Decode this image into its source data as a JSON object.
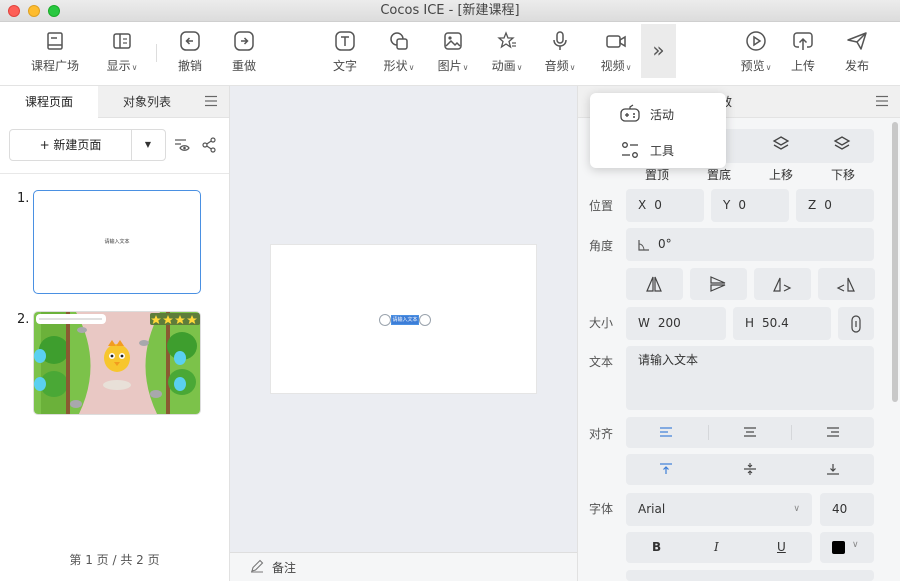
{
  "window": {
    "title": "Cocos ICE - [新建课程]"
  },
  "toolbar": {
    "items": [
      {
        "label": "课程广场",
        "icon": "book-icon"
      },
      {
        "label": "显示",
        "icon": "display-icon",
        "caret": "∨"
      },
      {
        "label": "撤销",
        "icon": "undo-icon"
      },
      {
        "label": "重做",
        "icon": "redo-icon"
      },
      {
        "label": "文字",
        "icon": "text-icon"
      },
      {
        "label": "形状",
        "icon": "shape-icon",
        "caret": "∨"
      },
      {
        "label": "图片",
        "icon": "image-icon",
        "caret": "∨"
      },
      {
        "label": "动画",
        "icon": "animation-icon",
        "caret": "∨"
      },
      {
        "label": "音频",
        "icon": "microphone-icon",
        "caret": "∨"
      },
      {
        "label": "视频",
        "icon": "video-icon",
        "caret": "∨"
      },
      {
        "label": "预览",
        "icon": "play-icon",
        "caret": "∨"
      },
      {
        "label": "上传",
        "icon": "upload-icon"
      },
      {
        "label": "发布",
        "icon": "send-icon"
      }
    ],
    "more": "»"
  },
  "left_panel": {
    "tabs": [
      "课程页面",
      "对象列表"
    ],
    "new_page_button": "+ 新建页面",
    "dropdown_arrow": "▼",
    "pages": [
      {
        "number": "1.",
        "preview_text": "请输入文本"
      },
      {
        "number": "2."
      }
    ],
    "footer": "第 1 页 / 共 2 页"
  },
  "canvas": {
    "text_element": "请输入文本",
    "note_label": "备注"
  },
  "popup_menu": {
    "items": [
      {
        "label": "活动",
        "icon": "gamepad-icon"
      },
      {
        "label": "工具",
        "icon": "tool-icon"
      }
    ]
  },
  "right_panel": {
    "tab_label": "动效",
    "layer_buttons": [
      "置顶",
      "置底",
      "上移",
      "下移"
    ],
    "position": {
      "label": "位置",
      "x_label": "X",
      "x": "0",
      "y_label": "Y",
      "y": "0",
      "z_label": "Z",
      "z": "0"
    },
    "angle": {
      "label": "角度",
      "value": "0°"
    },
    "size": {
      "label": "大小",
      "w_label": "W",
      "w": "200",
      "h_label": "H",
      "h": "50.4"
    },
    "text": {
      "label": "文本",
      "value": "请输入文本"
    },
    "align": {
      "label": "对齐"
    },
    "font": {
      "label": "字体",
      "family": "Arial",
      "size": "40",
      "bold": "B",
      "italic": "I",
      "underline": "U",
      "color": "#000000"
    }
  }
}
